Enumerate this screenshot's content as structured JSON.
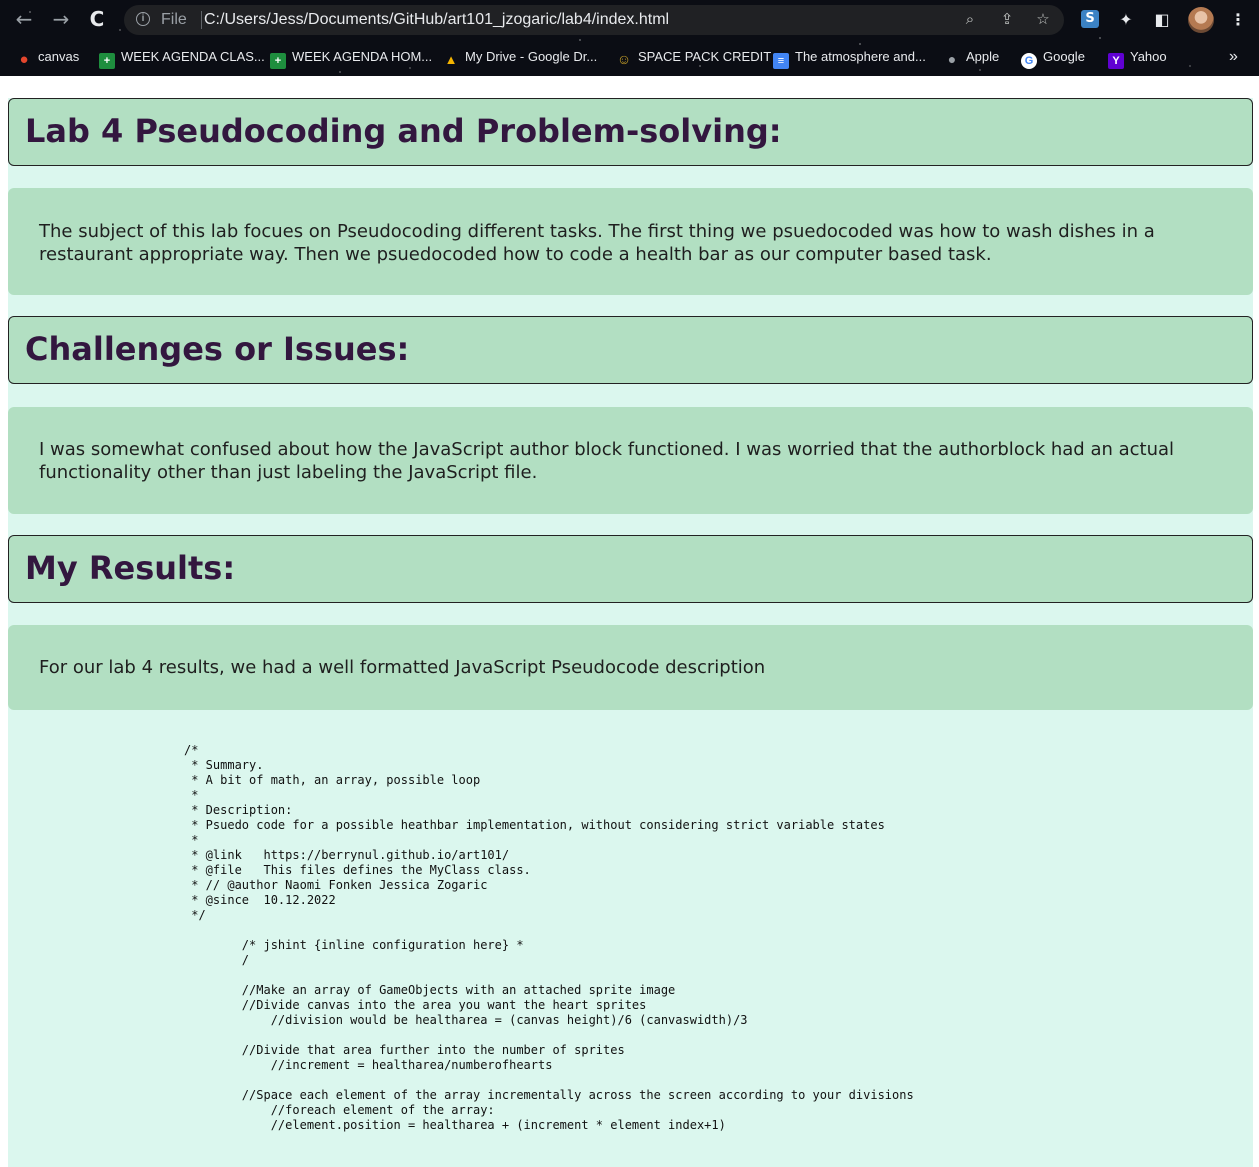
{
  "browser": {
    "back_icon": "←",
    "forward_icon": "→",
    "reload_icon": "C",
    "info_icon": "i",
    "file_label": "File",
    "url": "C:/Users/Jess/Documents/GitHub/art101_jzogaric/lab4/index.html",
    "zoom_icon": "⌕",
    "share_icon": "⇪",
    "star_icon": "☆",
    "ext_s_label": "S",
    "puzzle_icon": "✦",
    "sidepanel_icon": "◧",
    "menu_icon": "⋮"
  },
  "bookmarks": {
    "items": [
      {
        "label": "canvas",
        "icon": "canvas-icon",
        "glyph": "●",
        "color": "#e4462d"
      },
      {
        "label": "WEEK AGENDA CLAS...",
        "icon": "sheets-icon",
        "glyph": "+",
        "color": "#1e8e3e"
      },
      {
        "label": "WEEK AGENDA HOM...",
        "icon": "sheets-icon",
        "glyph": "+",
        "color": "#1e8e3e"
      },
      {
        "label": "My Drive - Google Dr...",
        "icon": "drive-icon",
        "glyph": "▲",
        "color": "#f4b400"
      },
      {
        "label": "SPACE PACK CREDIT",
        "icon": "space-pack-icon",
        "glyph": "☺",
        "color": "#c9a227"
      },
      {
        "label": "The atmosphere and...",
        "icon": "docs-icon",
        "glyph": "≡",
        "color": "#4285f4"
      },
      {
        "label": "Apple",
        "icon": "apple-icon",
        "glyph": "●",
        "color": "#9aa0a6"
      },
      {
        "label": "Google",
        "icon": "google-icon",
        "glyph": "G",
        "color": "#ffffff"
      },
      {
        "label": "Yahoo",
        "icon": "yahoo-icon",
        "glyph": "Y",
        "color": "#6001d2"
      }
    ],
    "more_label": "»"
  },
  "page": {
    "sections": [
      {
        "heading": "Lab 4 Pseudocoding and Problem-solving:",
        "text": "The subject of this lab focues on Pseudocoding different tasks. The first thing we psuedocoded was how to wash dishes in a restaurant appropriate way. Then we psuedocoded how to code a health bar as our computer based task."
      },
      {
        "heading": "Challenges or Issues:",
        "text": "I was somewhat confused about how the JavaScript author block functioned. I was worried that the authorblock had an actual functionality other than just labeling the JavaScript file."
      },
      {
        "heading": "My Results:",
        "text": "For our lab 4 results, we had a well formatted JavaScript Pseudocode description"
      }
    ],
    "code": "/*\n * Summary.\n * A bit of math, an array, possible loop\n *\n * Description:\n * Psuedo code for a possible heathbar implementation, without considering strict variable states\n *\n * @link   https://berrynul.github.io/art101/\n * @file   This files defines the MyClass class.\n * // @author Naomi Fonken Jessica Zogaric\n * @since  10.12.2022\n */\n\n        /* jshint {inline configuration here} *\n        /\n\n        //Make an array of GameObjects with an attached sprite image\n        //Divide canvas into the area you want the heart sprites\n            //division would be healtharea = (canvas height)/6 (canvaswidth)/3\n\n        //Divide that area further into the number of sprites\n            //increment = healtharea/numberofhearts\n\n        //Space each element of the array incrementally across the screen according to your divisions\n            //foreach element of the array:\n            //element.position = healtharea + (increment * element index+1)"
  },
  "colors": {
    "page_background": "#dbf7ee",
    "box_background": "#b2dfc2",
    "heading_text": "#33173f"
  }
}
